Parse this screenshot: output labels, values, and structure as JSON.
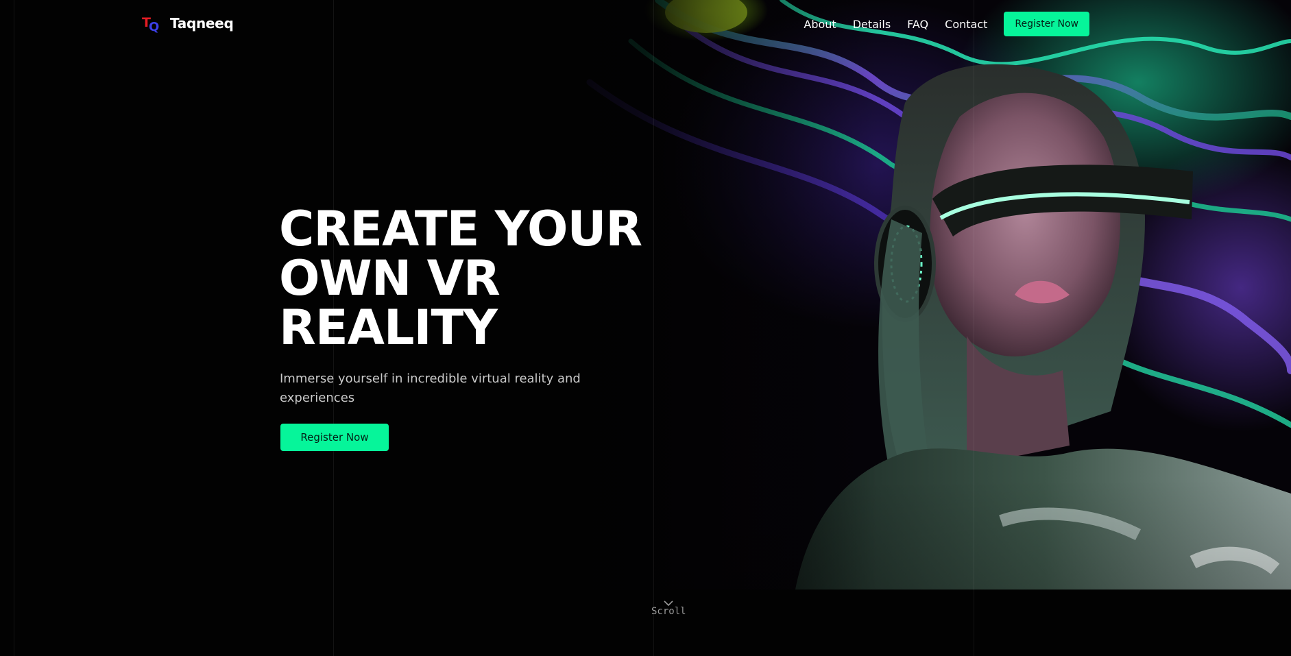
{
  "brand": {
    "name": "Taqneeq",
    "logo_text": "TQ",
    "logo_colors": [
      "#e31c24",
      "#3b3fe6"
    ]
  },
  "nav": {
    "links": [
      "About",
      "Details",
      "FAQ",
      "Contact"
    ],
    "cta_label": "Register Now"
  },
  "hero": {
    "title_lines": [
      "CREATE YOUR",
      "OWN VR",
      "REALITY"
    ],
    "subtitle": "Immerse yourself in incredible virtual reality and experiences",
    "cta_label": "Register Now",
    "image_icon": "vr-headset-woman-image"
  },
  "scroll": {
    "label": "Scroll",
    "icon": "chevron-down-icon"
  },
  "colors": {
    "accent": "#06f59a",
    "background": "#020202",
    "text": "#ffffff",
    "muted_text": "#c9c9c9"
  }
}
